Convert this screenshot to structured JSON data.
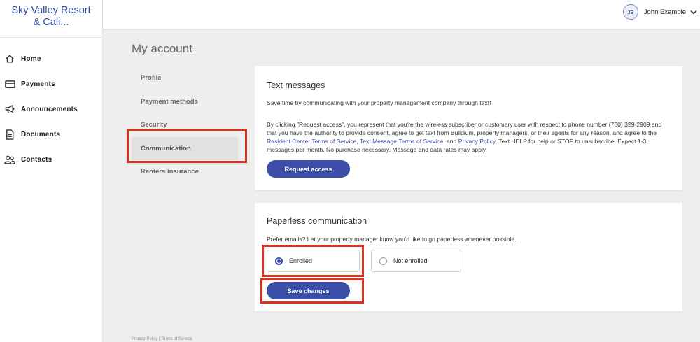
{
  "brand": {
    "line1": "Sky Valley Resort",
    "line2": "& Cali..."
  },
  "sidebar": {
    "items": [
      {
        "label": "Home",
        "icon": "home-icon"
      },
      {
        "label": "Payments",
        "icon": "credit-card-icon"
      },
      {
        "label": "Announcements",
        "icon": "megaphone-icon"
      },
      {
        "label": "Documents",
        "icon": "document-icon"
      },
      {
        "label": "Contacts",
        "icon": "contacts-icon"
      }
    ]
  },
  "header": {
    "initials": "JE",
    "user_name": "John Example",
    "menu_icon": "chevron-down-icon"
  },
  "page": {
    "title": "My account",
    "subnav": [
      {
        "label": "Profile"
      },
      {
        "label": "Payment methods"
      },
      {
        "label": "Security"
      },
      {
        "label": "Communication"
      },
      {
        "label": "Renters insurance"
      }
    ],
    "active_subnav": "Communication"
  },
  "text_messages": {
    "title": "Text messages",
    "intro": "Save time by communicating with your property management company through text!",
    "consent_part1": "By clicking \"Request access\", you represent that you're the wireless subscriber or customary user with respect to phone number (760) 329-2909 and that you have the authority to provide consent, agree to get text from Buildium, property managers, or their agents for any reason, and agree to the ",
    "link_resident_terms": "Resident Center Terms of Service",
    "sep1": ", ",
    "link_text_terms": "Text Message Terms of Service",
    "sep2": ", and ",
    "link_privacy": "Privacy Policy",
    "consent_part2": ". Text HELP for help or STOP to unsubscribe. Expect 1-3 messages per month. No purchase necessary. Message and data rates may apply.",
    "button_label": "Request access"
  },
  "paperless": {
    "title": "Paperless communication",
    "intro": "Prefer emails? Let your property manager know you'd like to go paperless whenever possible.",
    "options": [
      {
        "label": "Enrolled",
        "checked": true
      },
      {
        "label": "Not enrolled",
        "checked": false
      }
    ],
    "save_label": "Save changes"
  },
  "footer": {
    "text": "Privacy Policy | Terms of Service"
  },
  "colors": {
    "brand": "#2f4aa0",
    "primary": "#3b4fa8",
    "highlight": "#d9321f",
    "background": "#eeeeee"
  }
}
